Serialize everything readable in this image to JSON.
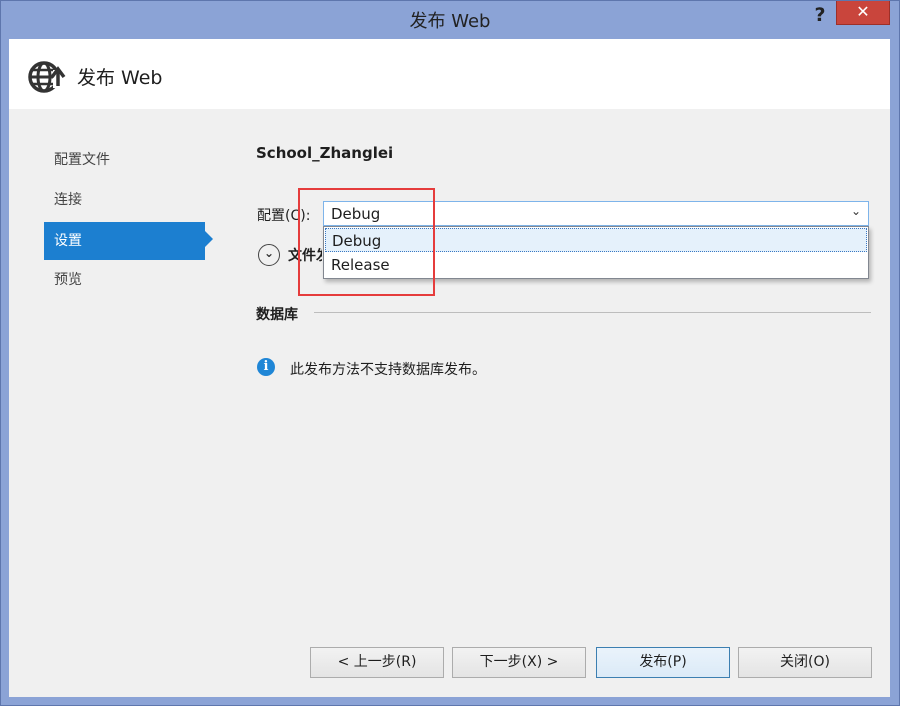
{
  "window": {
    "title": "发布 Web",
    "help_label": "?",
    "close_label": "✕"
  },
  "header": {
    "title": "发布 Web",
    "icon": "globe-publish-icon"
  },
  "nav": {
    "items": [
      {
        "label": "配置文件",
        "active": false
      },
      {
        "label": "连接",
        "active": false
      },
      {
        "label": "设置",
        "active": true
      },
      {
        "label": "预览",
        "active": false
      }
    ]
  },
  "settings": {
    "project_name": "School_Zhanglei",
    "config_label": "配置(C):",
    "config_value": "Debug",
    "config_options": [
      "Debug",
      "Release"
    ],
    "selected_option": "Debug",
    "file_section_label": "文件发布选项",
    "expand_glyph": "⌄",
    "database_label": "数据库",
    "info_text": "此发布方法不支持数据库发布。",
    "info_glyph": "i"
  },
  "buttons": {
    "prev": "< 上一步(R)",
    "next": "下一步(X) >",
    "publish": "发布(P)",
    "close": "关闭(O)"
  },
  "colors": {
    "accent": "#1c7fd0",
    "titlebar": "#8ba3d6",
    "close_button": "#c9453c",
    "highlight_box": "#e53c3c"
  }
}
